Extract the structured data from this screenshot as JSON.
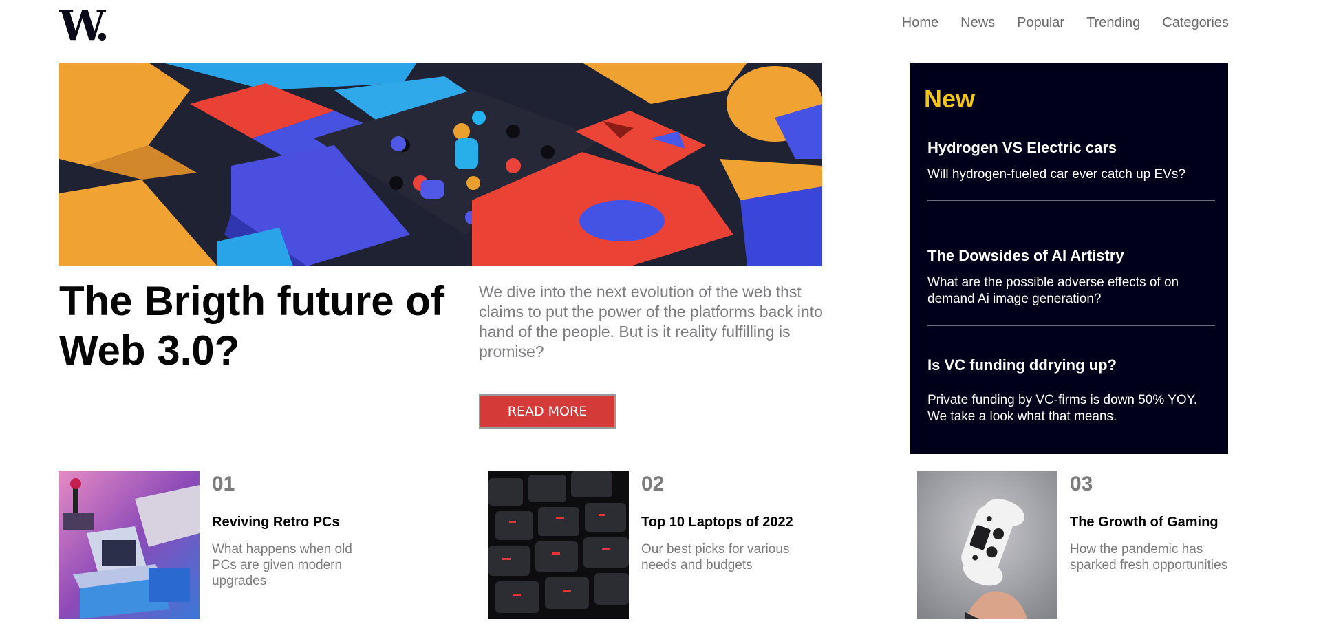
{
  "brand": {
    "logo_text": "W."
  },
  "nav": {
    "items": [
      "Home",
      "News",
      "Popular",
      "Trending",
      "Categories"
    ]
  },
  "hero": {
    "image_icon": "abstract-3d-blocks-image",
    "title": "The Brigth future of Web 3.0?",
    "description": "We dive into the next evolution of the web thst claims to put the power of the platforms back into hand of the people. But is it reality fulfilling is promise?",
    "cta_label": "READ MORE"
  },
  "new_panel": {
    "title": "New",
    "items": [
      {
        "title": "Hydrogen VS Electric cars",
        "desc": "Will hydrogen-fueled car ever catch up EVs?"
      },
      {
        "title": "The Dowsides of AI Artistry",
        "desc": "What are the possible adverse effects of on demand Ai image generation?"
      },
      {
        "title": "Is VC funding ddrying up?",
        "desc": "Private funding by VC-firms is down 50% YOY. We take a look what that means."
      }
    ]
  },
  "cards": [
    {
      "num": "01",
      "title": "Reviving Retro PCs",
      "desc": "What happens when old PCs are given modern upgrades",
      "image_icon": "retro-pc-image"
    },
    {
      "num": "02",
      "title": "Top 10 Laptops of 2022",
      "desc": "Our best picks for various needs and budgets",
      "image_icon": "laptop-keyboard-image"
    },
    {
      "num": "03",
      "title": "The Growth of Gaming",
      "desc": "How the pandemic has sparked fresh opportunities",
      "image_icon": "game-controller-image"
    }
  ],
  "colors": {
    "accent_red": "#d43a38",
    "panel_bg": "#00001b",
    "panel_title": "#f2c51c",
    "muted_text": "#7c7c7c"
  }
}
